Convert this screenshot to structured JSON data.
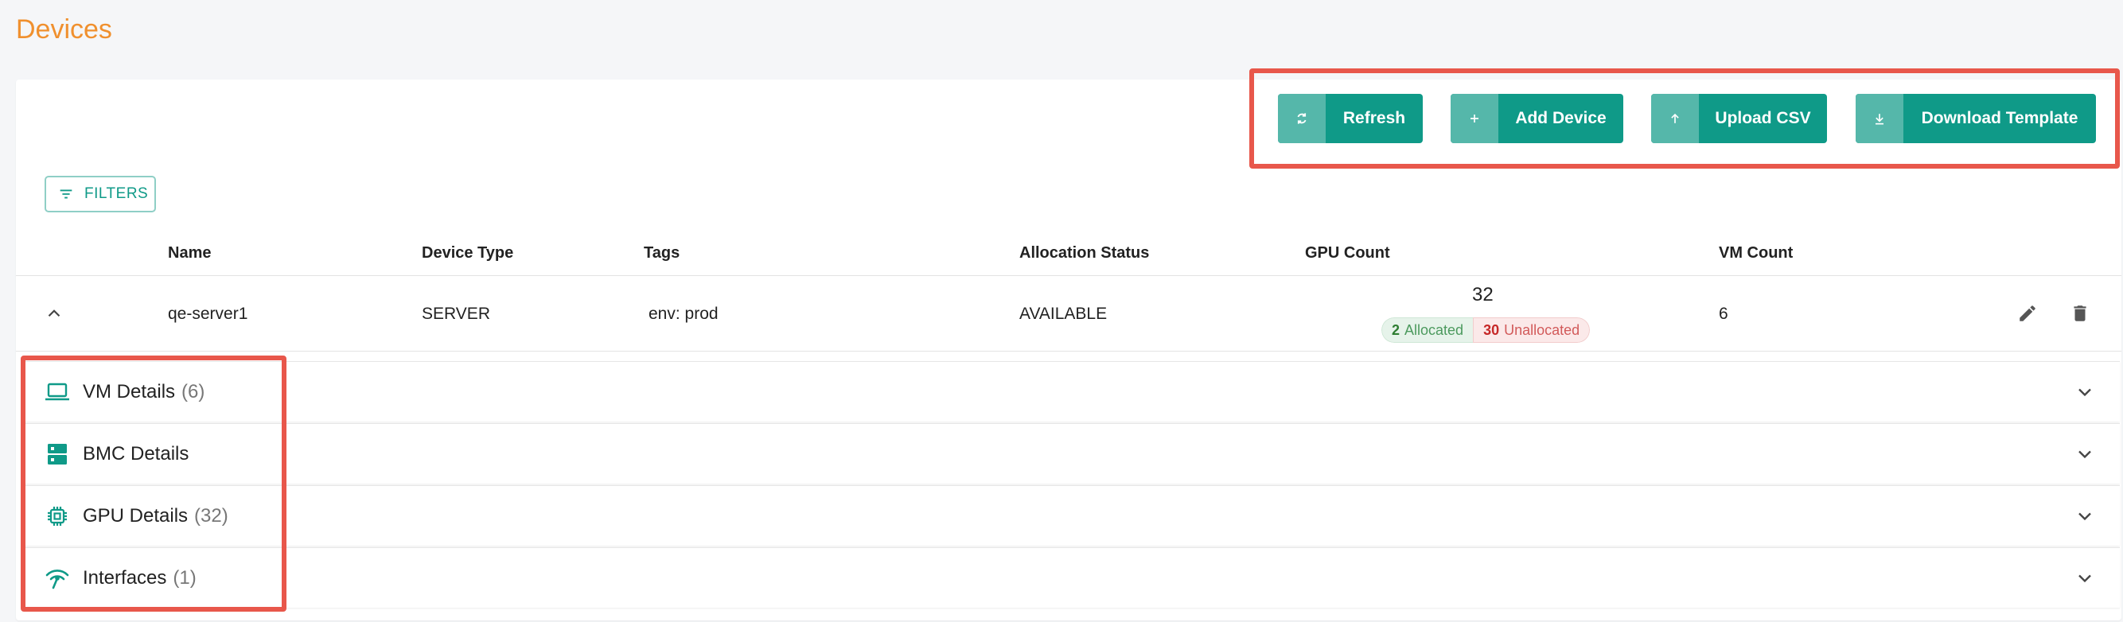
{
  "page": {
    "title": "Devices"
  },
  "toolbar": {
    "refresh": "Refresh",
    "add_device": "Add Device",
    "upload_csv": "Upload CSV",
    "download_template": "Download Template"
  },
  "filters": {
    "label": "FILTERS"
  },
  "table": {
    "columns": [
      "Name",
      "Device Type",
      "Tags",
      "Allocation Status",
      "GPU Count",
      "VM Count"
    ],
    "rows": [
      {
        "name": "qe-server1",
        "device_type": "SERVER",
        "tags": "env: prod",
        "allocation_status": "AVAILABLE",
        "gpu_count": "32",
        "gpu_allocated_count": "2",
        "gpu_allocated_label": "Allocated",
        "gpu_unallocated_count": "30",
        "gpu_unallocated_label": "Unallocated",
        "vm_count": "6"
      }
    ]
  },
  "details": [
    {
      "label": "VM Details",
      "count": "(6)",
      "icon": "laptop-icon"
    },
    {
      "label": "BMC Details",
      "count": "",
      "icon": "server-icon"
    },
    {
      "label": "GPU Details",
      "count": "(32)",
      "icon": "chip-icon"
    },
    {
      "label": "Interfaces",
      "count": "(1)",
      "icon": "network-icon"
    }
  ],
  "colors": {
    "accent": "#0f9a88",
    "title": "#f0902e",
    "highlight": "#e8574b"
  }
}
